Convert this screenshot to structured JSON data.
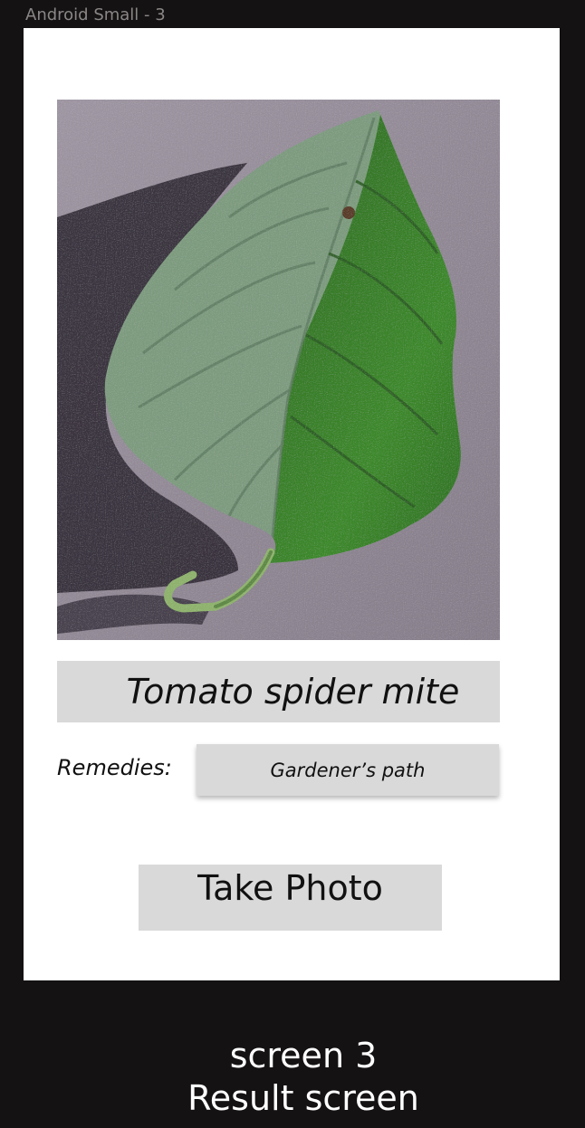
{
  "frame": {
    "label": "Android Small - 3"
  },
  "screen": {
    "result_title": "Tomato spider mite",
    "remedies_label": "Remedies:",
    "remedy_option": "Gardener’s path",
    "take_photo_label": "Take Photo"
  },
  "caption": {
    "line1": "screen 3",
    "line2": "Result screen"
  },
  "colors": {
    "canvas_bg": "#151213",
    "screen_bg": "#ffffff",
    "box_fill": "#d9d9d9"
  }
}
